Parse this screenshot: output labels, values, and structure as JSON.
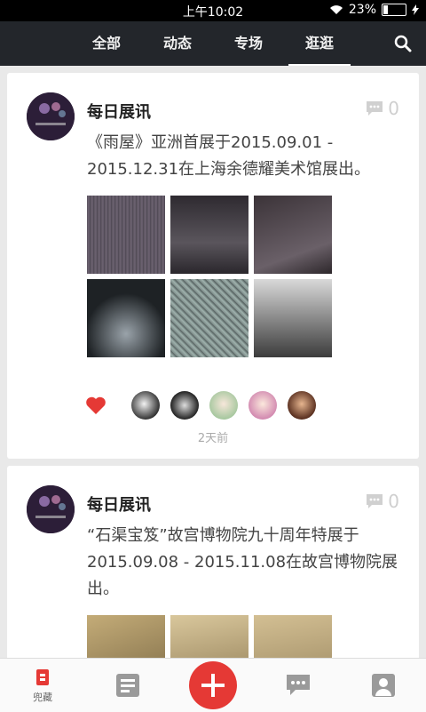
{
  "status_bar": {
    "time": "上午10:02",
    "battery": "23%",
    "battery_level": 0.23
  },
  "top_nav": {
    "tabs": [
      "全部",
      "动态",
      "专场",
      "逛逛"
    ],
    "active_index": 3
  },
  "feed": {
    "posts": [
      {
        "author": "每日展讯",
        "comment_count": "0",
        "text": "《雨屋》亚洲首展于2015.09.01 - 2015.12.31在上海余德耀美术馆展出。",
        "time": "2天前"
      },
      {
        "author": "每日展讯",
        "comment_count": "0",
        "text": "“石渠宝笈”故宫博物院九十周年特展于2015.09.08 - 2015.11.08在故宫博物院展出。",
        "time": ""
      }
    ]
  },
  "bottom_nav": {
    "favorites_label": "兜藏"
  },
  "colors": {
    "accent": "#e53935",
    "nav_bg": "#23262b"
  }
}
